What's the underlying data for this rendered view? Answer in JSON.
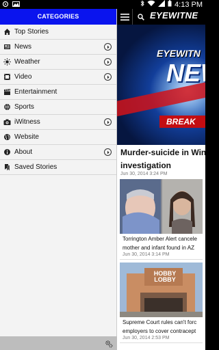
{
  "status_bar": {
    "time": "4:13 PM",
    "left_icons": [
      "location-icon",
      "gallery-icon"
    ],
    "right_icons": [
      "bluetooth-icon",
      "wifi-icon",
      "signal-icon",
      "battery-icon"
    ]
  },
  "drawer": {
    "header": "CATEGORIES",
    "accent_color": "#0a14ee",
    "items": [
      {
        "label": "Top Stories",
        "icon": "home-icon",
        "has_chevron": false
      },
      {
        "label": "News",
        "icon": "newspaper-icon",
        "has_chevron": true
      },
      {
        "label": "Weather",
        "icon": "sun-icon",
        "has_chevron": true
      },
      {
        "label": "Video",
        "icon": "film-icon",
        "has_chevron": true
      },
      {
        "label": "Entertainment",
        "icon": "clapperboard-icon",
        "has_chevron": false
      },
      {
        "label": "Sports",
        "icon": "ball-icon",
        "has_chevron": false
      },
      {
        "label": "iWitness",
        "icon": "camera-icon",
        "has_chevron": true
      },
      {
        "label": "Website",
        "icon": "globe-icon",
        "has_chevron": false
      },
      {
        "label": "About",
        "icon": "info-icon",
        "has_chevron": true
      },
      {
        "label": "Saved Stories",
        "icon": "bookmark-icon",
        "has_chevron": false
      }
    ],
    "footer_icon": "settings-icon"
  },
  "appbar": {
    "logo": "EYEWITNE",
    "menu_icon": "hamburger-icon",
    "search_icon": "search-icon"
  },
  "hero": {
    "ew_text": "EYEWITN",
    "news_text": "NEW",
    "breaking_text": "BREAK"
  },
  "lead_story": {
    "title_line1": "Murder-suicide in Win",
    "title_line2": "investigation",
    "date": "Jun 30, 2014 3:24 PM"
  },
  "cards": [
    {
      "title_line1": "Torrington Amber Alert cancele",
      "title_line2": "mother and infant found in AZ",
      "date": "Jun 30, 2014 3:14 PM"
    },
    {
      "title_line1": "Supreme Court rules can't forc",
      "title_line2": "employers to cover contracept",
      "date": "Jun 30, 2014 2:53 PM",
      "sign_text": "HOBBY LOBBY"
    }
  ]
}
